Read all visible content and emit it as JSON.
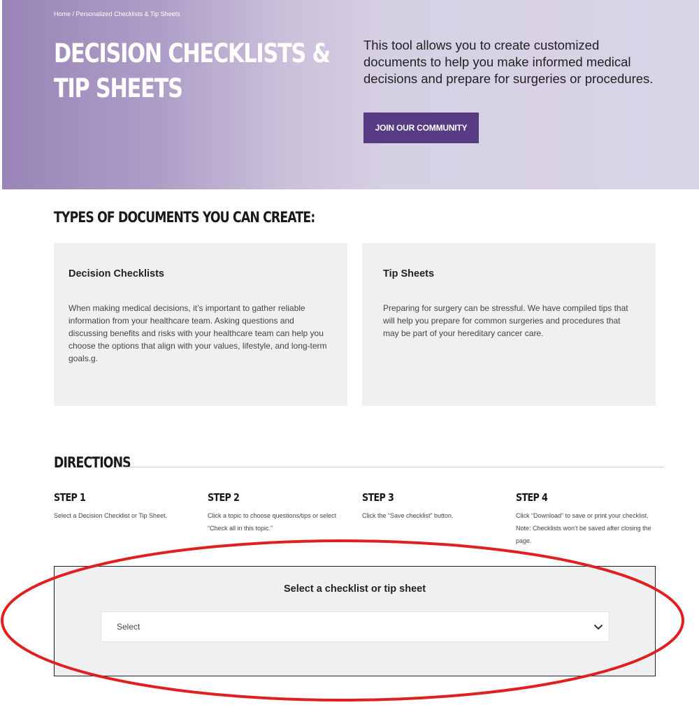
{
  "hero": {
    "breadcrumb_home": "Home",
    "breadcrumb_sep": " / ",
    "breadcrumb_current": "Personalized Checklists & Tip Sheets",
    "title": "Decision Checklists & Tip Sheets",
    "description": "This tool allows you to create customized documents to help you make informed medical decisions and prepare for surgeries or procedures.",
    "cta_label": "JOIN OUR COMMUNITY"
  },
  "types": {
    "heading": "TYPES OF DOCUMENTS YOU CAN CREATE:",
    "cards": [
      {
        "title": "Decision Checklists",
        "text": "When making medical decisions, it’s important to gather reliable information from your healthcare team. Asking questions and discussing benefits and risks with your healthcare team can help you choose the options that align with your values, lifestyle, and long-term goals.g."
      },
      {
        "title": "Tip Sheets",
        "text": "Preparing for surgery can be stressful. We have compiled tips that will help you prepare for common surgeries and procedures that may be part of your hereditary cancer care."
      }
    ]
  },
  "directions": {
    "heading": "DIRECTIONS",
    "steps": [
      {
        "title": "STEP 1",
        "text": "Select a Decision Checklist or Tip Sheet."
      },
      {
        "title": "STEP 2",
        "text": "Click a topic to choose questions/tips or select “Check all in this topic.”"
      },
      {
        "title": "STEP 3",
        "text": "Click the “Save checklist” button."
      },
      {
        "title": "STEP 4",
        "text": "Click “Download” to save or print your checklist. Note: Checklists won’t be saved after closing the page."
      }
    ]
  },
  "selector": {
    "label": "Select a checklist or tip sheet",
    "value": "Select"
  },
  "colors": {
    "accent": "#573b85",
    "annotation": "#e02020",
    "card_bg": "#eff0f2"
  },
  "icons": {
    "dropdown": "chevron-down-icon"
  }
}
